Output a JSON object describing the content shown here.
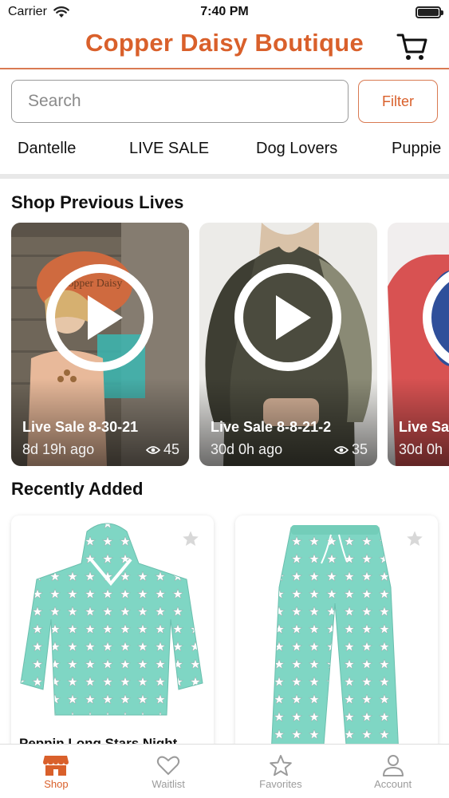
{
  "status_bar": {
    "carrier": "Carrier",
    "time": "7:40 PM"
  },
  "header": {
    "title": "Copper Daisy Boutique"
  },
  "search": {
    "placeholder": "Search",
    "filter_label": "Filter"
  },
  "categories": [
    "Dantelle",
    "LIVE SALE",
    "Dog Lovers",
    "Puppie"
  ],
  "previous_lives": {
    "title": "Shop Previous Lives",
    "cards": [
      {
        "title": "Live Sale 8-30-21",
        "ago": "8d 19h ago",
        "views": "45",
        "sign_text": "Copper Daisy"
      },
      {
        "title": "Live Sale 8-8-21-2",
        "ago": "30d 0h ago",
        "views": "35"
      },
      {
        "title": "Live Sa",
        "ago": "30d 0h"
      }
    ]
  },
  "recently_added": {
    "title": "Recently Added",
    "products": [
      {
        "name": "Peppin Long Stars Night"
      },
      {
        "name": ""
      }
    ]
  },
  "tabbar": {
    "tabs": [
      {
        "label": "Shop",
        "icon": "storefront-icon",
        "active": true
      },
      {
        "label": "Waitlist",
        "icon": "heart-icon",
        "active": false
      },
      {
        "label": "Favorites",
        "icon": "star-icon",
        "active": false
      },
      {
        "label": "Account",
        "icon": "person-icon",
        "active": false
      }
    ]
  },
  "colors": {
    "brand": "#d9602b",
    "mint": "#7fd6c4",
    "inactive": "#9b9b9b"
  }
}
